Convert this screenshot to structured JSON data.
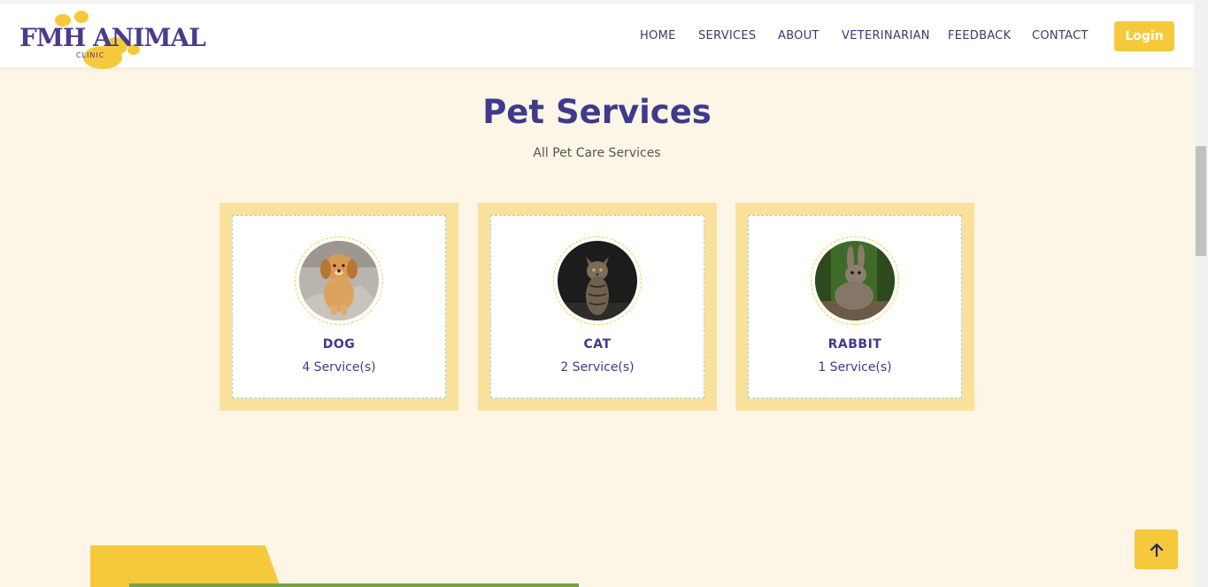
{
  "brand": {
    "name": "FMH ANIMAL",
    "sub": "CLINIC"
  },
  "nav": {
    "items": [
      {
        "label": "HOME",
        "name": "nav-home"
      },
      {
        "label": "SERVICES",
        "name": "nav-services"
      },
      {
        "label": "ABOUT",
        "name": "nav-about"
      },
      {
        "label": "VETERINARIAN",
        "name": "nav-veterinarian"
      },
      {
        "label": "FEEDBACK",
        "name": "nav-feedback"
      },
      {
        "label": "CONTACT",
        "name": "nav-contact"
      }
    ],
    "login_label": "Login"
  },
  "section": {
    "title": "Pet Services",
    "subtitle": "All Pet Care Services"
  },
  "cards": [
    {
      "name": "DOG",
      "count": "4 Service(s)",
      "image": "golden-retriever-puppy"
    },
    {
      "name": "CAT",
      "count": "2 Service(s)",
      "image": "tabby-kitten"
    },
    {
      "name": "RABBIT",
      "count": "1 Service(s)",
      "image": "brown-rabbit"
    }
  ],
  "scroll_top_icon": "arrow-up-icon",
  "colors": {
    "accent": "#f6c93d",
    "primary_text": "#3f3a8c",
    "page_bg": "#fdf6e6",
    "card_frame": "#f9e19c"
  }
}
